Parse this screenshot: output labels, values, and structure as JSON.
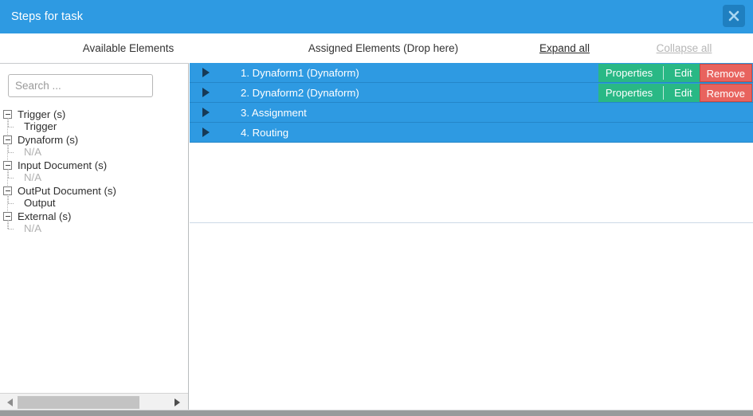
{
  "window": {
    "title": "Steps for task",
    "close_icon": "close-icon",
    "close_label": "X"
  },
  "columns": {
    "available_label": "Available Elements",
    "assigned_label": "Assigned Elements (Drop here)",
    "expand_all_label": "Expand all",
    "collapse_all_label": "Collapse all"
  },
  "search": {
    "value": "",
    "placeholder": "Search ..."
  },
  "tree": [
    {
      "label": "Trigger (s)",
      "toggle_icon": "minus-box-icon",
      "children": [
        {
          "label": "Trigger",
          "muted": false
        }
      ]
    },
    {
      "label": "Dynaform (s)",
      "toggle_icon": "minus-box-icon",
      "children": [
        {
          "label": "N/A",
          "muted": true
        }
      ]
    },
    {
      "label": "Input Document (s)",
      "toggle_icon": "minus-box-icon",
      "children": [
        {
          "label": "N/A",
          "muted": true
        }
      ]
    },
    {
      "label": "OutPut Document (s)",
      "toggle_icon": "minus-box-icon",
      "children": [
        {
          "label": "Output",
          "muted": false
        }
      ]
    },
    {
      "label": "External (s)",
      "toggle_icon": "minus-box-icon",
      "children": [
        {
          "label": "N/A",
          "muted": true
        }
      ]
    }
  ],
  "steps": [
    {
      "label": "1. Dynaform1 (Dynaform)",
      "arrow_icon": "triangle-right-icon",
      "has_actions": true,
      "properties_label": "Properties",
      "edit_label": "Edit",
      "remove_label": "Remove"
    },
    {
      "label": "2. Dynaform2 (Dynaform)",
      "arrow_icon": "triangle-right-icon",
      "has_actions": true,
      "properties_label": "Properties",
      "edit_label": "Edit",
      "remove_label": "Remove"
    },
    {
      "label": "3. Assignment",
      "arrow_icon": "triangle-right-icon",
      "has_actions": false
    },
    {
      "label": "4. Routing",
      "arrow_icon": "triangle-right-icon",
      "has_actions": false
    }
  ],
  "scrollbar": {
    "left_arrow_icon": "triangle-left-icon",
    "right_arrow_icon": "triangle-right-icon"
  },
  "colors": {
    "header_blue": "#2e9ae2",
    "row_blue": "#2e9ae2",
    "green_button": "#29b885",
    "red_button": "#e8635e",
    "close_button": "#1f7fc0"
  }
}
